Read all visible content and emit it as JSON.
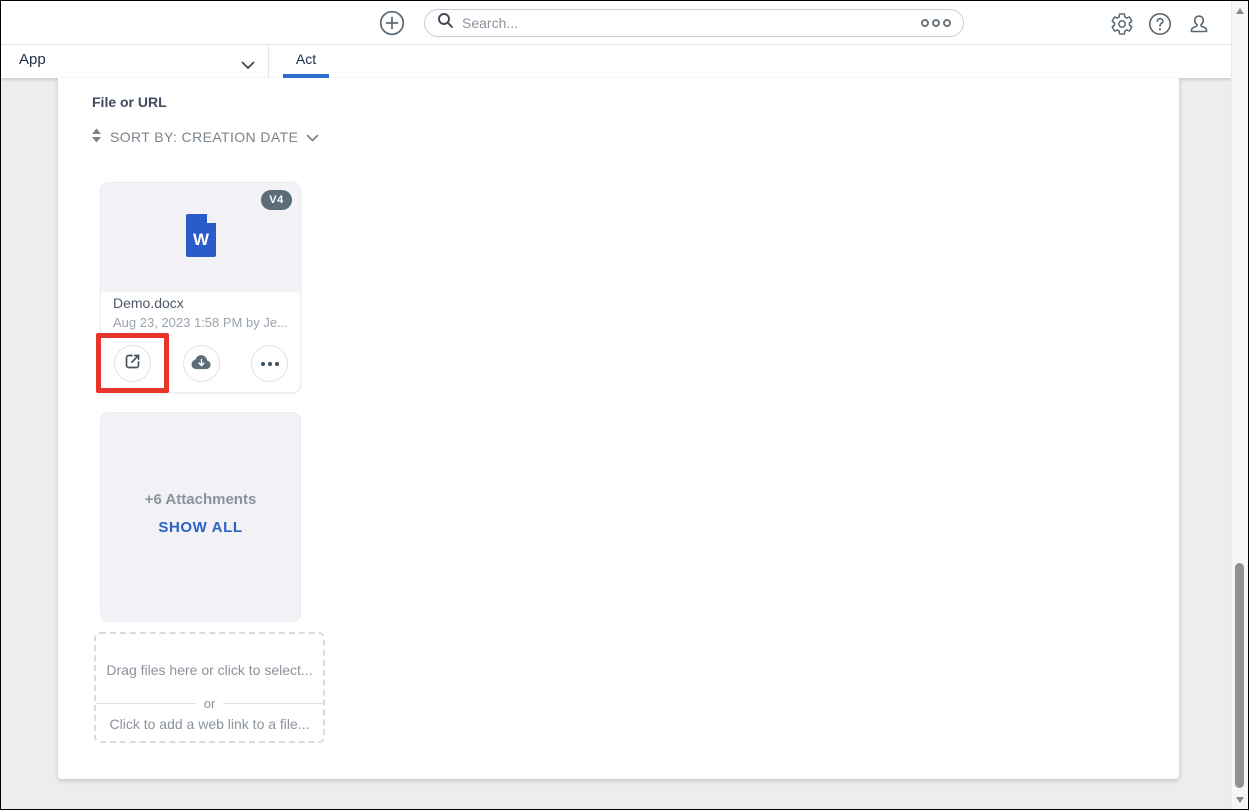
{
  "topbar": {
    "search": {
      "placeholder": "Search..."
    },
    "icons": {
      "add": "plus-circle-icon",
      "search": "magnifier-icon",
      "search_options": "three-circles-icon",
      "settings": "gear-icon",
      "help": "question-mark-icon",
      "account": "person-icon"
    }
  },
  "tabbar": {
    "dropdown_label": "App",
    "active_tab_label": "Act"
  },
  "content": {
    "section_title": "File or URL",
    "sort": {
      "label": "SORT BY: CREATION DATE"
    },
    "file_card": {
      "version_badge": "V4",
      "file_type": "word-document",
      "file_name": "Demo.docx",
      "file_meta": "Aug 23, 2023 1:58 PM by Je...",
      "actions": [
        "open-in-new-window",
        "download",
        "more-options"
      ]
    },
    "attachments_card": {
      "count_label": "+6 Attachments",
      "show_all_label": "SHOW ALL"
    },
    "dropzone": {
      "drag_label": "Drag files here or click to select...",
      "or_label": "or",
      "web_link_label": "Click to add a web link to a file..."
    }
  },
  "annotation": {
    "type": "red-highlight-box",
    "target": "open-in-new-window-button"
  },
  "colors": {
    "tab_accent_blue": "#2e6fd0",
    "show_all_blue": "#2a63c4",
    "word_icon_blue": "#2b5bc9",
    "annotation_red": "#e8352c",
    "version_badge_gray": "#5d6d77"
  }
}
